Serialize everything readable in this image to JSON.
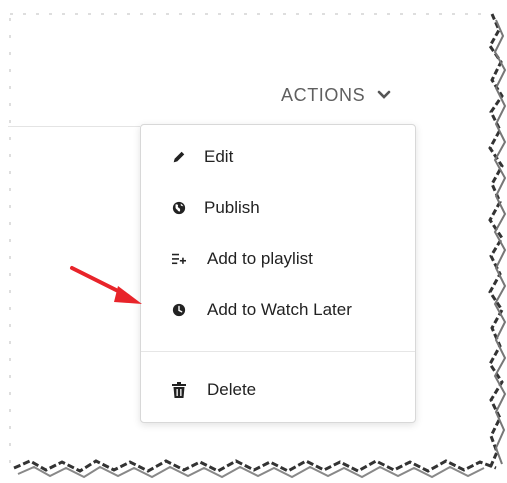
{
  "header": {
    "actions_label": "ACTIONS",
    "chevron_icon": "chevron-down-icon"
  },
  "menu": {
    "items": [
      {
        "label": "Edit",
        "icon": "pencil-icon"
      },
      {
        "label": "Publish",
        "icon": "globe-icon"
      },
      {
        "label": "Add to playlist",
        "icon": "playlist-add-icon"
      },
      {
        "label": "Add to Watch Later",
        "icon": "clock-icon"
      },
      {
        "label": "Delete",
        "icon": "trash-icon"
      }
    ]
  },
  "annotation": {
    "arrow_icon": "red-arrow-icon",
    "arrow_color": "#e8242a"
  },
  "colors": {
    "text": "#222222",
    "muted": "#5f5f5f",
    "border": "#d8d8d8"
  }
}
